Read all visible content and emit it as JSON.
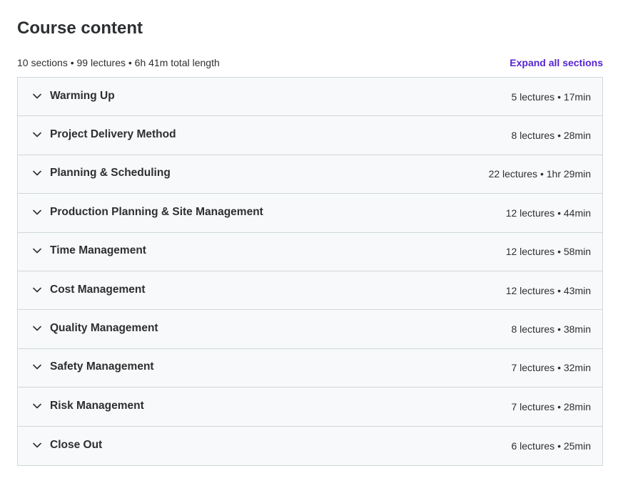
{
  "page": {
    "title": "Course content"
  },
  "summary": {
    "text": "10 sections • 99 lectures • 6h 41m total length",
    "expand_label": "Expand all sections"
  },
  "colors": {
    "accent": "#5624d0",
    "text": "#2d2f31",
    "border": "#d1d7dc",
    "row_background": "#f7f9fa"
  },
  "icons": {
    "row_toggle": "chevron-down-icon"
  },
  "sections": [
    {
      "title": "Warming Up",
      "meta": "5 lectures • 17min"
    },
    {
      "title": "Project Delivery Method",
      "meta": "8 lectures • 28min"
    },
    {
      "title": "Planning & Scheduling",
      "meta": "22 lectures • 1hr 29min"
    },
    {
      "title": "Production Planning & Site Management",
      "meta": "12 lectures • 44min"
    },
    {
      "title": "Time Management",
      "meta": "12 lectures • 58min"
    },
    {
      "title": "Cost Management",
      "meta": "12 lectures • 43min"
    },
    {
      "title": "Quality Management",
      "meta": "8 lectures • 38min"
    },
    {
      "title": "Safety Management",
      "meta": "7 lectures • 32min"
    },
    {
      "title": "Risk Management",
      "meta": "7 lectures • 28min"
    },
    {
      "title": "Close Out",
      "meta": "6 lectures • 25min"
    }
  ]
}
